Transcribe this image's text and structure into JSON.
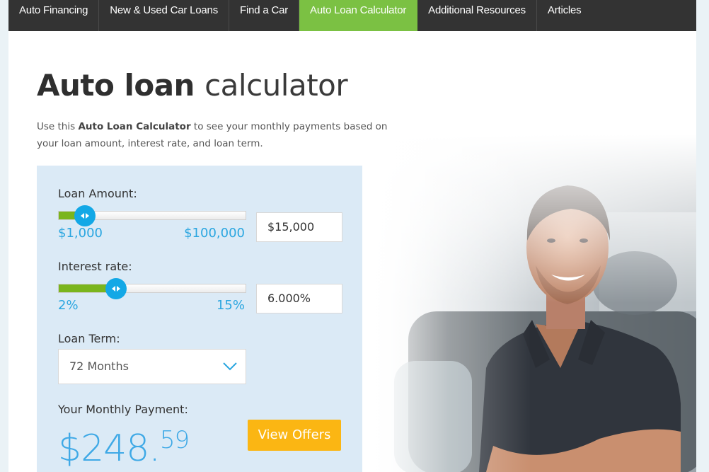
{
  "nav": {
    "items": [
      {
        "label": "Auto Financing",
        "active": false
      },
      {
        "label": "New & Used Car Loans",
        "active": false
      },
      {
        "label": "Find a Car",
        "active": false
      },
      {
        "label": "Auto Loan Calculator",
        "active": true
      },
      {
        "label": "Additional Resources",
        "active": false
      },
      {
        "label": "Articles",
        "active": false
      }
    ]
  },
  "header": {
    "title_bold": "Auto loan",
    "title_light": "calculator",
    "intro_pre": "Use this ",
    "intro_bold": "Auto Loan Calculator",
    "intro_post": " to see your monthly payments based on your loan amount, interest rate, and loan term."
  },
  "calculator": {
    "loan_amount": {
      "label": "Loan Amount:",
      "min_label": "$1,000",
      "max_label": "$100,000",
      "value": "$15,000",
      "min": 1000,
      "max": 100000,
      "current": 15000
    },
    "interest_rate": {
      "label": "Interest rate:",
      "min_label": "2%",
      "max_label": "15%",
      "value": "6.000%",
      "min": 2,
      "max": 15,
      "current": 6
    },
    "loan_term": {
      "label": "Loan Term:",
      "selected": "72 Months"
    },
    "payment": {
      "label": "Your Monthly Payment:",
      "dollars": "$248.",
      "cents": "59"
    },
    "view_offers_label": "View Offers"
  },
  "colors": {
    "nav_bg": "#333333",
    "nav_active": "#7bc143",
    "panel_bg": "#dbeaf6",
    "slider_fill": "#7ab51d",
    "slider_handle": "#13a8e6",
    "accent_blue": "#3fa9e6",
    "button": "#fbb613"
  },
  "photo": {
    "description": "smiling man with arms crossed in front of cars"
  }
}
